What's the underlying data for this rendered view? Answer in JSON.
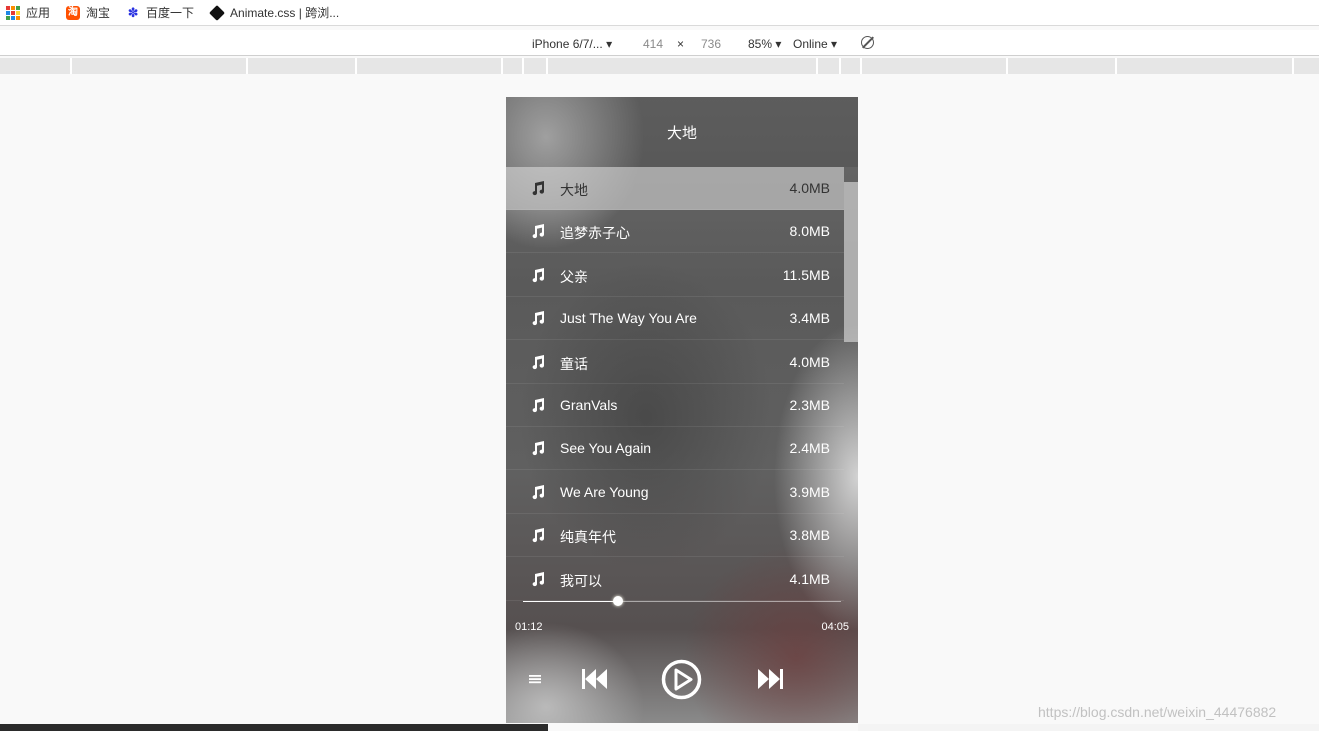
{
  "bookmarks": [
    {
      "label": "应用",
      "icon": "apps-grid-icon"
    },
    {
      "label": "淘宝",
      "icon": "taobao-icon"
    },
    {
      "label": "百度一下",
      "icon": "baidu-paw-icon"
    },
    {
      "label": "Animate.css | 跨浏...",
      "icon": "animate-diamond-icon"
    }
  ],
  "device_toolbar": {
    "device": "iPhone 6/7/...",
    "width": "414",
    "separator": "×",
    "height": "736",
    "zoom": "85%",
    "network": "Online",
    "rotate_icon": "rotate-icon"
  },
  "player": {
    "title": "大地",
    "songs": [
      {
        "name": "大地",
        "size": "4.0MB",
        "active": true
      },
      {
        "name": "追梦赤子心",
        "size": "8.0MB"
      },
      {
        "name": "父亲",
        "size": "11.5MB"
      },
      {
        "name": "Just The Way You Are",
        "size": "3.4MB"
      },
      {
        "name": "童话",
        "size": "4.0MB"
      },
      {
        "name": "GranVals",
        "size": "2.3MB"
      },
      {
        "name": "See You Again",
        "size": "2.4MB"
      },
      {
        "name": "We Are Young",
        "size": "3.9MB"
      },
      {
        "name": "纯真年代",
        "size": "3.8MB"
      },
      {
        "name": "我可以",
        "size": "4.1MB"
      }
    ],
    "current_time": "01:12",
    "total_time": "04:05",
    "progress": 0.3,
    "controls": [
      "list-icon",
      "previous-icon",
      "play-icon",
      "next-icon"
    ]
  },
  "watermark": "https://blog.csdn.net/weixin_44476882"
}
